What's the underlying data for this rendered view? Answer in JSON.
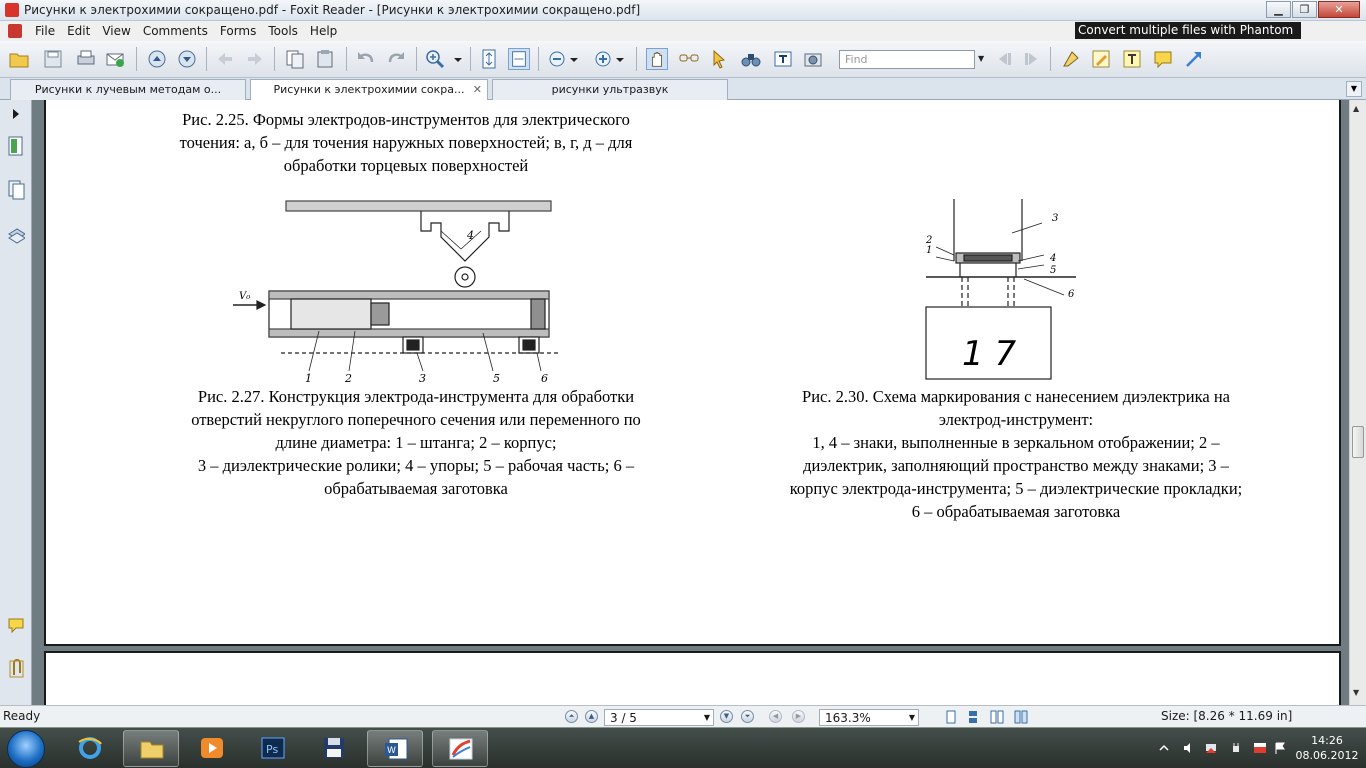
{
  "window": {
    "title": "Рисунки к электрохимии сокращено.pdf - Foxit Reader - [Рисунки к электрохимии сокращено.pdf]",
    "minimize": "▁",
    "restore": "❐",
    "close": "✕"
  },
  "menu": {
    "items": [
      "File",
      "Edit",
      "View",
      "Comments",
      "Forms",
      "Tools",
      "Help"
    ],
    "promo": "Convert multiple files with Phantom"
  },
  "toolbar": {
    "find_placeholder": "Find"
  },
  "tabs": [
    {
      "label": "Рисунки к лучевым методам о..."
    },
    {
      "label": "Рисунки к электрохимии сокра...",
      "close": "✕"
    },
    {
      "label": "рисунки ультразвук"
    }
  ],
  "document": {
    "fig225_caption": [
      "Рис. 2.25. Формы электродов-инструментов для электрического",
      "точения: а, б – для точения наружных поверхностей; в, г, д – для",
      "обработки торцевых поверхностей"
    ],
    "fig227_caption": [
      "Рис. 2.27. Конструкция электрода-инструмента для обработки",
      "отверстий некруглого поперечного сечения или переменного по",
      "длине диаметра: 1 – штанга; 2 – корпус;",
      "3 – диэлектрические ролики; 4 – упоры; 5 – рабочая часть; 6 –",
      "обрабатываемая заготовка"
    ],
    "fig230_caption": [
      "Рис. 2.30. Схема маркирования с нанесением диэлектрика на",
      "электрод-инструмент:",
      "1, 4 – знаки, выполненные в зеркальном отображении; 2 –",
      "диэлектрик, заполняющий пространство между знаками; 3 –",
      "корпус электрода-инструмента; 5 – диэлектрические прокладки;",
      "6 – обрабатываемая заготовка"
    ],
    "fig227_labels": {
      "v": "V₀",
      "l1": "1",
      "l2": "2",
      "l3": "3",
      "l4": "4",
      "l5": "5",
      "l6": "6"
    },
    "fig230_labels": {
      "l1": "1",
      "l2": "2",
      "l3": "3",
      "l4": "4",
      "l5": "5",
      "l6": "6",
      "marking": "1 7"
    }
  },
  "status": {
    "ready": "Ready",
    "page": "3 / 5",
    "zoom": "163.3%",
    "size": "Size: [8.26 * 11.69 in]"
  },
  "taskbar": {
    "time": "14:26",
    "date": "08.06.2012"
  },
  "colors": {
    "accent": "#3b6ea5",
    "page_bg": "#ffffff",
    "doc_bg": "#6f7c82"
  }
}
